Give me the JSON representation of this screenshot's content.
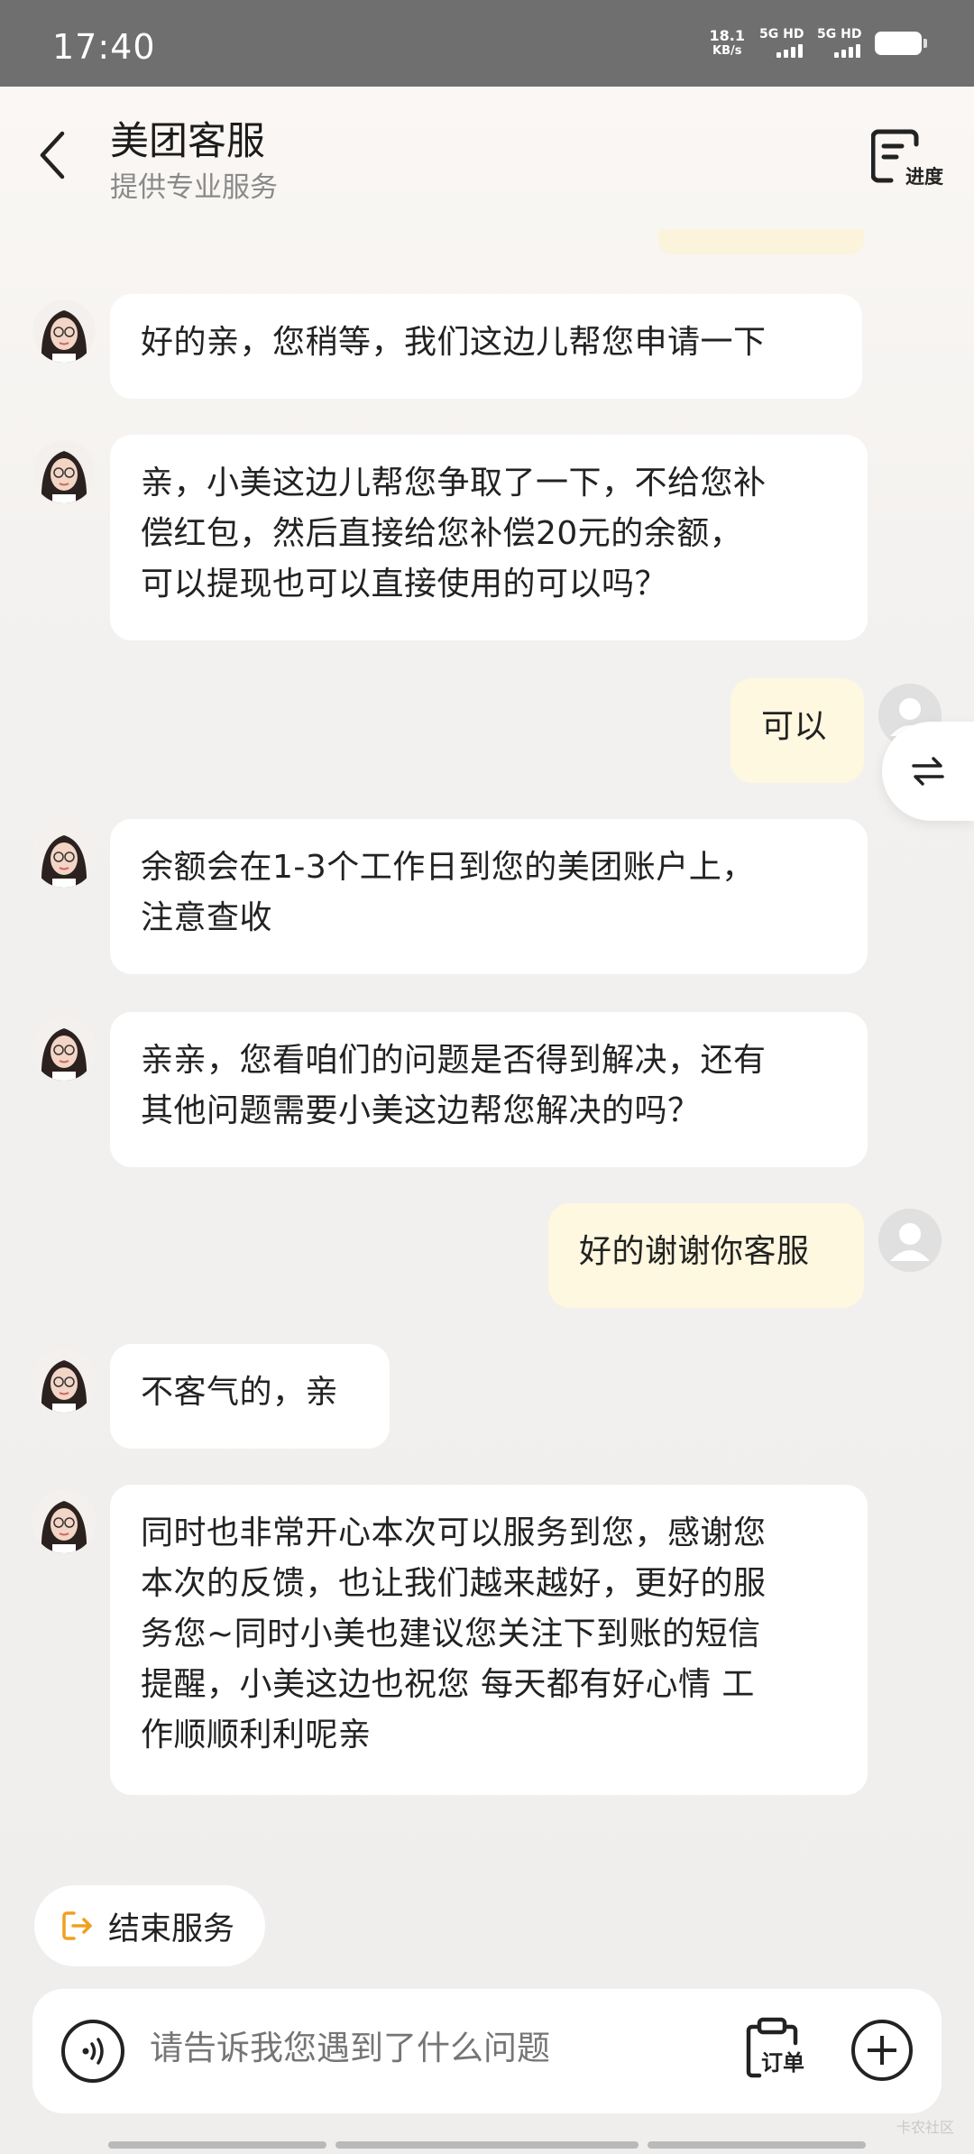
{
  "status_bar": {
    "time": "17:40",
    "net_speed_value": "18.1",
    "net_speed_unit": "KB/s",
    "sim1_label": "5G HD",
    "sim2_label": "5G HD"
  },
  "header": {
    "title": "美团客服",
    "subtitle": "提供专业服务",
    "progress_label": "进度"
  },
  "messages": [
    {
      "from": "agent",
      "text": "好的亲，您稍等，我们这边儿帮您申请一下"
    },
    {
      "from": "agent",
      "lines": [
        "亲，小美这边儿帮您争取了一下，不给您补",
        "偿红包，然后直接给您补偿20元的余额，",
        "可以提现也可以直接使用的可以吗？"
      ]
    },
    {
      "from": "user",
      "text": "可以"
    },
    {
      "from": "agent",
      "lines": [
        "余额会在1-3个工作日到您的美团账户上，",
        "注意查收"
      ]
    },
    {
      "from": "agent",
      "lines": [
        "亲亲，您看咱们的问题是否得到解决，还有",
        "其他问题需要小美这边帮您解决的吗？"
      ]
    },
    {
      "from": "user",
      "text": "好的谢谢你客服"
    },
    {
      "from": "agent",
      "text": "不客气的，亲"
    },
    {
      "from": "agent",
      "lines": [
        "同时也非常开心本次可以服务到您，感谢您",
        "本次的反馈，也让我们越来越好，更好的服",
        "务您~同时小美也建议您关注下到账的短信",
        "提醒，小美这边也祝您 每天都有好心情 工",
        "作顺顺利利呢亲"
      ]
    }
  ],
  "end_service_label": "结束服务",
  "input": {
    "placeholder": "请告诉我您遇到了什么问题",
    "order_label": "订单"
  },
  "watermark": "卡农社区",
  "colors": {
    "agent_bubble": "#ffffff",
    "user_bubble": "#fdf8df",
    "accent_orange": "#f0a020"
  }
}
